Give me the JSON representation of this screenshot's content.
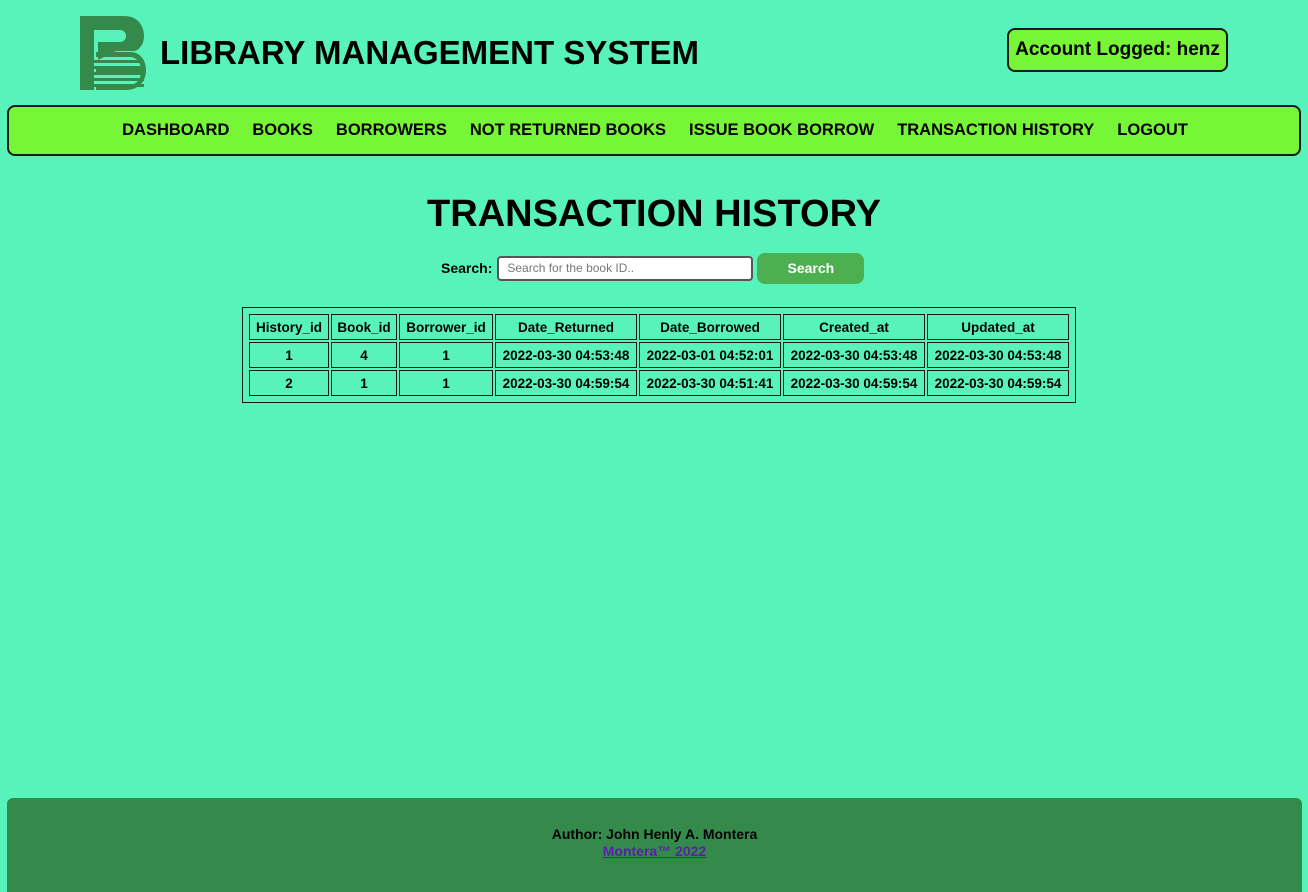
{
  "header": {
    "title": "LIBRARY MANAGEMENT SYSTEM",
    "account_label": "Account Logged: henz"
  },
  "nav": {
    "items": [
      {
        "label": "DASHBOARD"
      },
      {
        "label": "BOOKS"
      },
      {
        "label": "BORROWERS"
      },
      {
        "label": "NOT RETURNED BOOKS"
      },
      {
        "label": "ISSUE BOOK BORROW"
      },
      {
        "label": "TRANSACTION HISTORY"
      },
      {
        "label": "LOGOUT"
      }
    ]
  },
  "main": {
    "title": "TRANSACTION HISTORY",
    "search": {
      "label": "Search:",
      "placeholder": "Search for the book ID..",
      "value": "",
      "button_label": "Search"
    },
    "table": {
      "columns": [
        "History_id",
        "Book_id",
        "Borrower_id",
        "Date_Returned",
        "Date_Borrowed",
        "Created_at",
        "Updated_at"
      ],
      "rows": [
        [
          "1",
          "4",
          "1",
          "2022-03-30 04:53:48",
          "2022-03-01 04:52:01",
          "2022-03-30 04:53:48",
          "2022-03-30 04:53:48"
        ],
        [
          "2",
          "1",
          "1",
          "2022-03-30 04:59:54",
          "2022-03-30 04:51:41",
          "2022-03-30 04:59:54",
          "2022-03-30 04:59:54"
        ]
      ]
    }
  },
  "footer": {
    "author": "Author: John Henly A. Montera",
    "link_text": "Montera™ 2022"
  },
  "colors": {
    "background": "#58f2bb",
    "nav_background": "#76f636",
    "search_button": "#4caf50",
    "footer_background": "#338a4b",
    "logo": "#338a4b",
    "link": "#5a1fa8"
  },
  "icons": {
    "logo": "book-logo-icon"
  }
}
